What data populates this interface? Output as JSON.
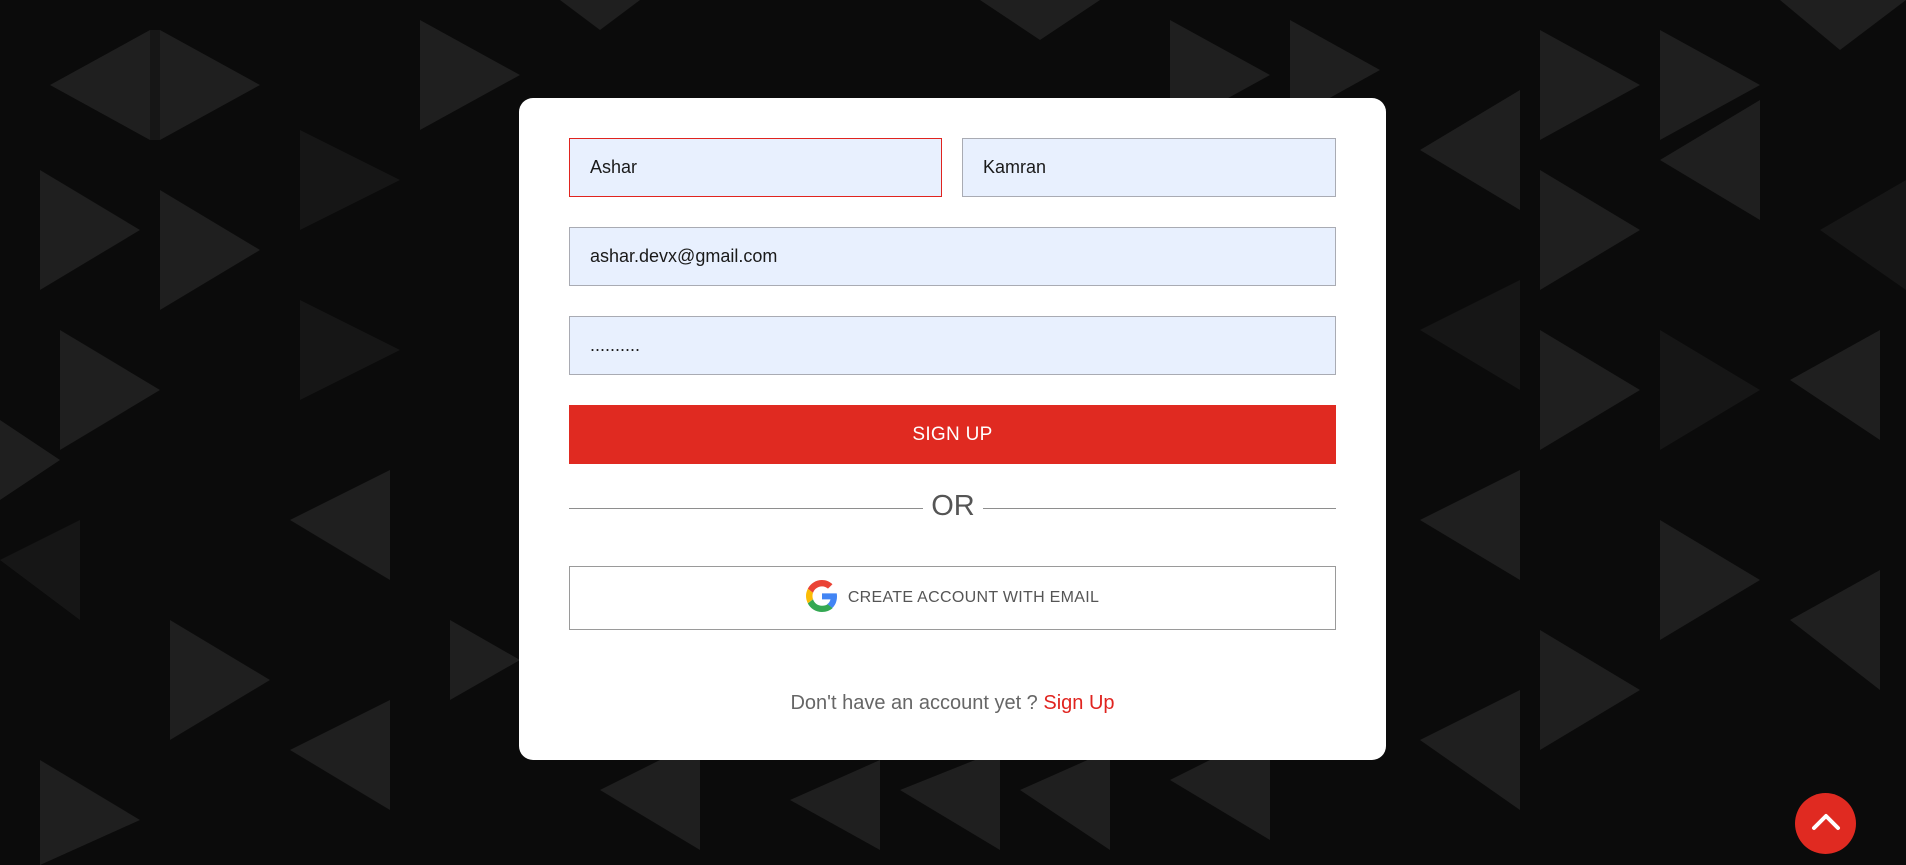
{
  "form": {
    "first_name_value": "Ashar",
    "last_name_value": "Kamran",
    "email_value": "ashar.devx@gmail.com",
    "password_value": "..........",
    "signup_label": "SIGN UP",
    "divider_label": "OR",
    "google_label": "CREATE ACCOUNT WITH EMAIL"
  },
  "footer": {
    "prompt": "Don't have an account yet ? ",
    "link_label": "Sign Up"
  },
  "icons": {
    "google": "google-icon",
    "scroll_top": "chevron-up-icon"
  },
  "colors": {
    "accent": "#e02a21",
    "input_bg": "#e8f0fe",
    "page_bg": "#0b0b0b",
    "card_bg": "#ffffff"
  }
}
